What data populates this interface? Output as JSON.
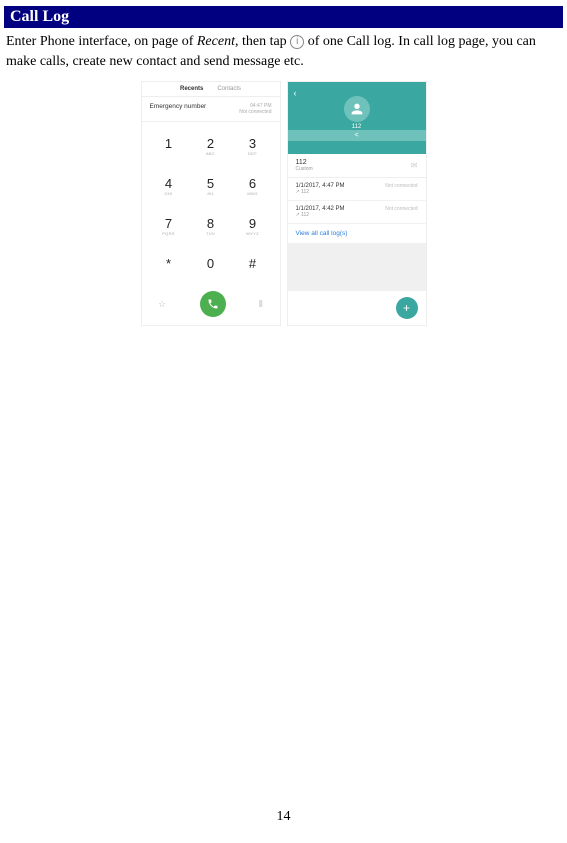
{
  "heading": "Call Log",
  "instruction": {
    "part1": "Enter Phone interface, on page of ",
    "recent": "Recent",
    "part2": ", then tap ",
    "part3": " of one Call log. In call log page, you can make calls, create new contact and send message etc."
  },
  "left_screen": {
    "tabs": {
      "recents": "Recents",
      "contacts": "Contacts"
    },
    "recent_item": {
      "name": "Emergency number",
      "time": "04:47 PM",
      "status": "Not connected"
    },
    "keys": [
      {
        "num": "1",
        "sub": ""
      },
      {
        "num": "2",
        "sub": "ABC"
      },
      {
        "num": "3",
        "sub": "DEF"
      },
      {
        "num": "4",
        "sub": "GHI"
      },
      {
        "num": "5",
        "sub": "JKL"
      },
      {
        "num": "6",
        "sub": "MNO"
      },
      {
        "num": "7",
        "sub": "PQRS"
      },
      {
        "num": "8",
        "sub": "TUV"
      },
      {
        "num": "9",
        "sub": "WXYZ"
      },
      {
        "num": "*",
        "sub": ""
      },
      {
        "num": "0",
        "sub": ""
      },
      {
        "num": "#",
        "sub": ""
      }
    ]
  },
  "right_screen": {
    "number": "112",
    "contact": {
      "num": "112",
      "type": "Custom"
    },
    "logs": [
      {
        "date": "1/1/2017, 4:47 PM",
        "sub": "↗ 112",
        "status": "Not connected"
      },
      {
        "date": "1/1/2017, 4:42 PM",
        "sub": "↗ 112",
        "status": "Not connected"
      }
    ],
    "view_all": "View all call log(s)"
  },
  "page_number": "14"
}
